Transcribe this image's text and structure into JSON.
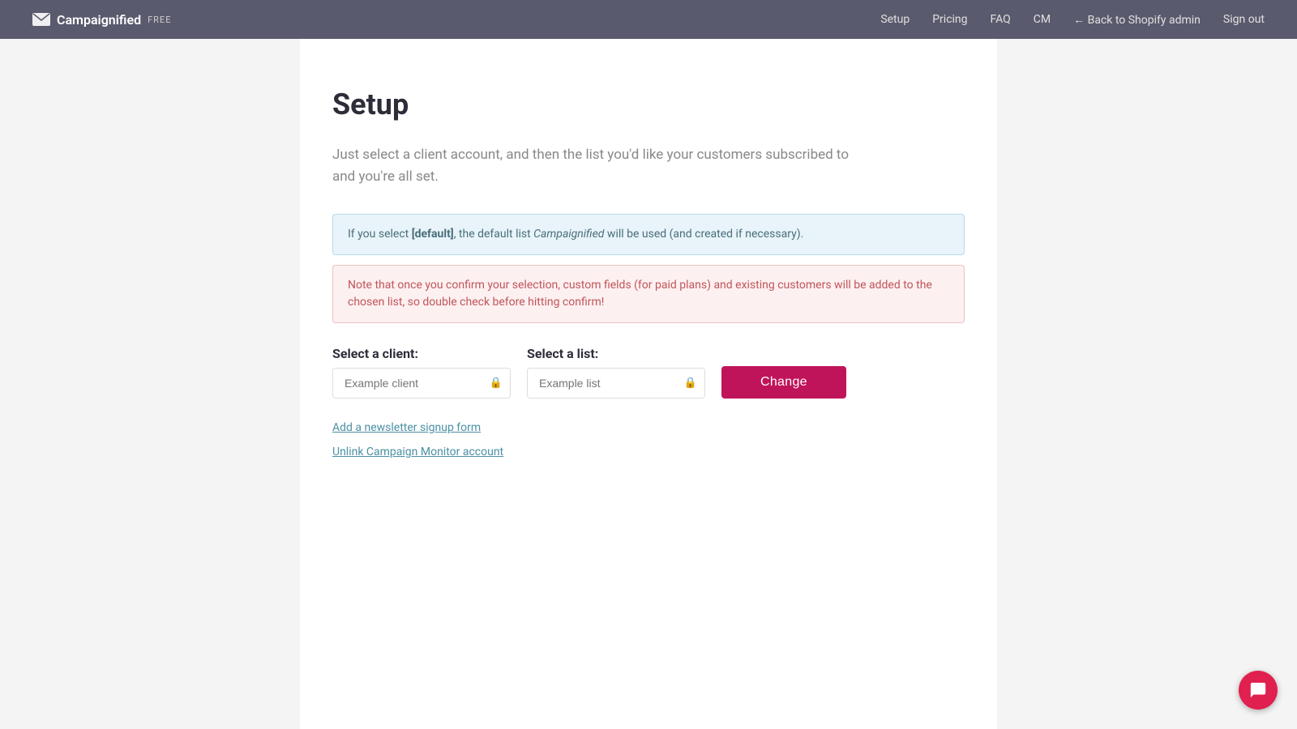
{
  "navbar": {
    "brand": {
      "app_name": "Campaignified",
      "badge": "FREE",
      "logo_alt": "mail-logo"
    },
    "links": [
      {
        "label": "Setup",
        "href": "#",
        "name": "nav-setup"
      },
      {
        "label": "Pricing",
        "href": "#",
        "name": "nav-pricing"
      },
      {
        "label": "FAQ",
        "href": "#",
        "name": "nav-faq"
      },
      {
        "label": "CM",
        "href": "#",
        "name": "nav-cm"
      },
      {
        "label": "← Back to Shopify admin",
        "href": "#",
        "name": "nav-back-shopify"
      },
      {
        "label": "Sign out",
        "href": "#",
        "name": "nav-sign-out"
      }
    ]
  },
  "page": {
    "title": "Setup",
    "subtitle": "Just select a client account, and then the list you'd like your customers subscribed to and you're all set.",
    "alert_info": {
      "prefix": "If you select ",
      "highlight": "[default]",
      "suffix": ", the default list ",
      "italic": "Campaignified",
      "end": " will be used (and created if necessary)."
    },
    "alert_warning": "Note that once you confirm your selection, custom fields (for paid plans) and existing customers will be added to the chosen list, so double check before hitting confirm!"
  },
  "form": {
    "client_label": "Select a client:",
    "client_placeholder": "Example client",
    "list_label": "Select a list:",
    "list_placeholder": "Example list",
    "change_button": "Change"
  },
  "links": {
    "add_newsletter": "Add a newsletter signup form",
    "unlink_campaign": "Unlink Campaign Monitor account"
  }
}
